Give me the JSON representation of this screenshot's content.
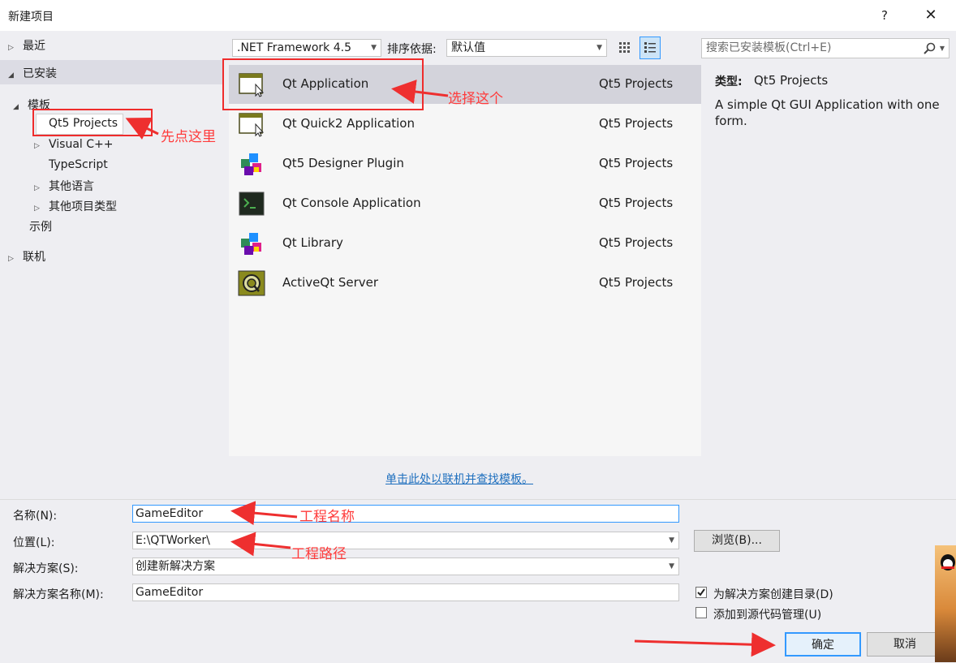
{
  "window": {
    "title": "新建项目",
    "help": "?",
    "close": "✕"
  },
  "sidebar": {
    "recent": "最近",
    "installed": "已安装",
    "templates": "模板",
    "items": [
      {
        "label": "Qt5 Projects"
      },
      {
        "label": "Visual C++"
      },
      {
        "label": "TypeScript"
      },
      {
        "label": "其他语言"
      },
      {
        "label": "其他项目类型"
      }
    ],
    "samples": "示例",
    "online": "联机"
  },
  "toolbar": {
    "framework": ".NET Framework 4.5",
    "sort_label": "排序依据:",
    "sort_value": "默认值"
  },
  "search": {
    "placeholder": "搜索已安装模板(Ctrl+E)"
  },
  "templates": [
    {
      "name": "Qt Application",
      "category": "Qt5 Projects",
      "icon": "qt-window-icon"
    },
    {
      "name": "Qt Quick2 Application",
      "category": "Qt5 Projects",
      "icon": "qt-window-icon"
    },
    {
      "name": "Qt5 Designer Plugin",
      "category": "Qt5 Projects",
      "icon": "cubes-icon"
    },
    {
      "name": "Qt Console Application",
      "category": "Qt5 Projects",
      "icon": "console-icon"
    },
    {
      "name": "Qt Library",
      "category": "Qt5 Projects",
      "icon": "cubes-icon"
    },
    {
      "name": "ActiveQt Server",
      "category": "Qt5 Projects",
      "icon": "activeqt-icon"
    }
  ],
  "details": {
    "type_label": "类型:",
    "type_value": "Qt5 Projects",
    "description": "A simple Qt GUI Application with one form."
  },
  "online_link": "单击此处以联机并查找模板。",
  "form": {
    "name_label": "名称(N):",
    "name_value": "GameEditor",
    "location_label": "位置(L):",
    "location_value": "E:\\QTWorker\\",
    "solution_label": "解决方案(S):",
    "solution_value": "创建新解决方案",
    "solution_name_label": "解决方案名称(M):",
    "solution_name_value": "GameEditor",
    "browse": "浏览(B)...",
    "create_dir_label": "为解决方案创建目录(D)",
    "create_dir_checked": true,
    "source_control_label": "添加到源代码管理(U)",
    "source_control_checked": false,
    "ok": "确定",
    "cancel": "取消"
  },
  "annotations": {
    "click_here": "先点这里",
    "choose_this": "选择这个",
    "project_name": "工程名称",
    "project_path": "工程路径"
  },
  "colors": {
    "annotation": "#ff3b3b",
    "selected_row": "#d3d3db",
    "link": "#1e6fbe"
  }
}
